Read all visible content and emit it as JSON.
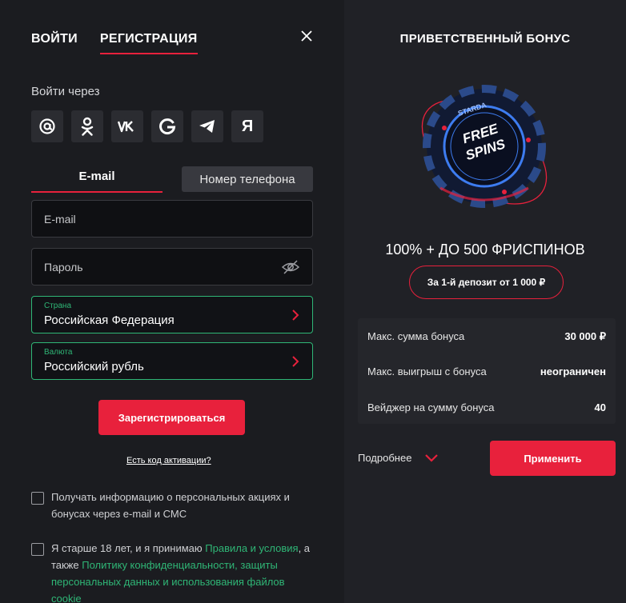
{
  "tabs": {
    "login": "ВОЙТИ",
    "register": "РЕГИСТРАЦИЯ"
  },
  "social": {
    "label": "Войти через",
    "items": [
      {
        "name": "mail-icon",
        "glyph": "@"
      },
      {
        "name": "odnoklassniki-icon",
        "glyph": "ok"
      },
      {
        "name": "vk-icon",
        "glyph": "VK"
      },
      {
        "name": "google-icon",
        "glyph": "G"
      },
      {
        "name": "telegram-icon",
        "glyph": "tg"
      },
      {
        "name": "yandex-icon",
        "glyph": "Я"
      }
    ]
  },
  "method_tabs": {
    "email": "E-mail",
    "phone": "Номер телефона"
  },
  "form": {
    "email_placeholder": "E-mail",
    "password_placeholder": "Пароль",
    "country_label": "Страна",
    "country_value": "Российская Федерация",
    "currency_label": "Валюта",
    "currency_value": "Российский рубль",
    "submit": "Зарегистрироваться",
    "activation_link": "Есть код активации?"
  },
  "consents": {
    "promo": "Получать информацию о персональных акциях и бонусах через e-mail и СМС",
    "age_prefix": "Я старше 18 лет, и я принимаю ",
    "rules_link": "Правила и условия",
    "age_middle": ", а также ",
    "policy_link": "Политику конфиденциальности, защиты персональных данных и использования файлов cookie"
  },
  "bonus": {
    "title": "ПРИВЕТСТВЕННЫЙ БОНУС",
    "chip_text_1": "FREE",
    "chip_text_2": "SPINS",
    "brand": "STARDA",
    "offer": "100% + ДО 500 ФРИСПИНОВ",
    "deposit": "За 1-й депозит от 1 000 ₽",
    "rows": [
      {
        "label": "Макс. сумма бонуса",
        "value": "30 000 ₽"
      },
      {
        "label": "Макс. выигрыш с бонуса",
        "value": "неограничен"
      },
      {
        "label": "Вейджер на сумму бонуса",
        "value": "40"
      }
    ],
    "more": "Подробнее",
    "apply": "Применить"
  },
  "colors": {
    "accent": "#e8213c",
    "green": "#2fb676",
    "bg": "#1b1c20",
    "panel": "#202126"
  }
}
